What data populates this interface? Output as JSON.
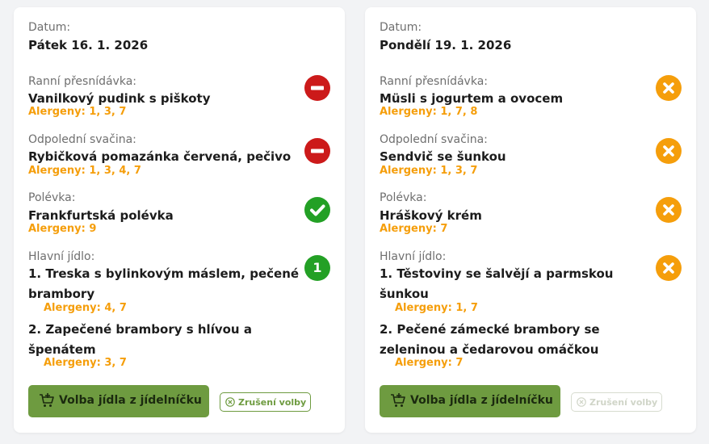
{
  "colors": {
    "accent_green": "#6e9b40",
    "allergen_orange": "#f59e0b",
    "status_red": "#cc1a1a",
    "status_green": "#23a025",
    "status_orange": "#f59e0b"
  },
  "cards": [
    {
      "date_label": "Datum:",
      "date": "Pátek 16. 1. 2026",
      "morning": {
        "label": "Ranní přesnídávka:",
        "food": "Vanilkový pudink s piškoty",
        "allergens": "Alergeny: 1, 3, 7",
        "status_icon": "minus-icon"
      },
      "afternoon": {
        "label": "Odpolední svačina:",
        "food": "Rybičková pomazánka červená, pečivo",
        "allergens": "Alergeny: 1, 3, 4, 7",
        "status_icon": "minus-icon"
      },
      "soup": {
        "label": "Polévka:",
        "food": "Frankfurtská polévka",
        "allergens": "Alergeny: 9",
        "status_icon": "check-icon"
      },
      "main": {
        "label": "Hlavní jídlo:",
        "selected_number": "1",
        "option1_line1": "1.  Treska s bylinkovým máslem, pečené",
        "option1_line2": "brambory",
        "option1_allergens": "Alergeny: 4, 7",
        "option2_line1": "2. Zapečené brambory s hlívou a",
        "option2_line2": "špenátem",
        "option2_allergens": "Alergeny: 3, 7"
      },
      "select_button": "Volba jídla z jídelníčku",
      "cancel_button": "Zrušení volby"
    },
    {
      "date_label": "Datum:",
      "date": "Pondělí 19. 1. 2026",
      "morning": {
        "label": "Ranní přesnídávka:",
        "food": "Müsli s jogurtem a ovocem",
        "allergens": "Alergeny: 1, 7, 8",
        "status_icon": "x-icon"
      },
      "afternoon": {
        "label": "Odpolední svačina:",
        "food": "Sendvič se šunkou",
        "allergens": "Alergeny: 1, 3, 7",
        "status_icon": "x-icon"
      },
      "soup": {
        "label": "Polévka:",
        "food": "Hráškový krém",
        "allergens": "Alergeny: 7",
        "status_icon": "x-icon"
      },
      "main": {
        "label": "Hlavní jídlo:",
        "option1_line1": "1.  Těstoviny se šalvějí a parmskou",
        "option1_line2": "šunkou",
        "option1_allergens": "Alergeny: 1, 7",
        "option2_line1": "2. Pečené zámecké brambory se",
        "option2_line2": "zeleninou a čedarovou omáčkou",
        "option2_allergens": "Alergeny: 7",
        "status_icon": "x-icon"
      },
      "select_button": "Volba jídla z jídelníčku",
      "cancel_button": "Zrušení volby",
      "cancel_disabled": true
    }
  ]
}
